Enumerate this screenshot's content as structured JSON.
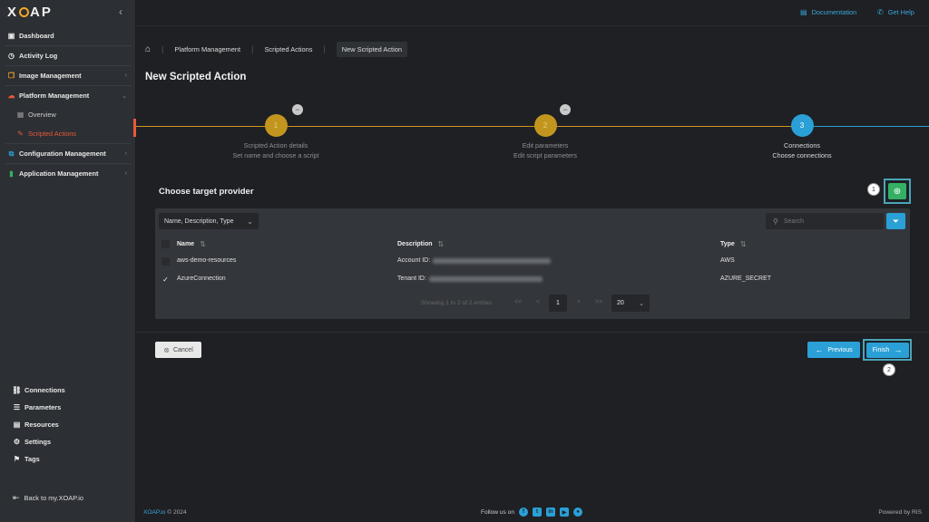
{
  "app": {
    "logo_prefix": "X",
    "logo_suffix": "AP"
  },
  "topbar": {
    "documentation": "Documentation",
    "help": "Get Help"
  },
  "sidebar": {
    "items": [
      {
        "label": "Dashboard"
      },
      {
        "label": "Activity Log"
      },
      {
        "label": "Image Management"
      },
      {
        "label": "Platform Management"
      },
      {
        "label": "Overview"
      },
      {
        "label": "Scripted Actions"
      },
      {
        "label": "Configuration Management"
      },
      {
        "label": "Application Management"
      }
    ],
    "bottom_items": [
      {
        "label": "Connections"
      },
      {
        "label": "Parameters"
      },
      {
        "label": "Resources"
      },
      {
        "label": "Settings"
      },
      {
        "label": "Tags"
      }
    ],
    "back_label": "Back to my.XOAP.io"
  },
  "breadcrumb": [
    "Platform Management",
    "Scripted Actions",
    "New Scripted Action"
  ],
  "page_title": "New Scripted Action",
  "stepper": [
    {
      "number": "1",
      "title": "Scripted Action details",
      "subtitle": "Set name and choose a script"
    },
    {
      "number": "2",
      "title": "Edit parameters",
      "subtitle": "Edit script parameters"
    },
    {
      "number": "3",
      "title": "Connections",
      "subtitle": "Choose connections"
    }
  ],
  "section_title": "Choose target provider",
  "filter": {
    "selected": "Name, Description, Type",
    "search_placeholder": "Search"
  },
  "table": {
    "headers": [
      "Name",
      "Description",
      "Type"
    ],
    "rows": [
      {
        "name": "aws-demo-resources",
        "description_label": "Account ID:",
        "type": "AWS",
        "checked": false
      },
      {
        "name": "AzureConnection",
        "description_label": "Tenant ID:",
        "type": "AZURE_SECRET",
        "checked": true
      }
    ]
  },
  "pagination": {
    "info": "Showing 1 to 2 of 2 entries",
    "first": "<<",
    "prev": "<",
    "current": "1",
    "next": ">",
    "last": ">>",
    "page_size": "20"
  },
  "callouts": {
    "add": "1",
    "finish": "2"
  },
  "actions": {
    "cancel": "Cancel",
    "previous": "Previous",
    "finish": "Finish"
  },
  "footer": {
    "brand": "XOAP.io",
    "copyright": "© 2024",
    "follow": "Follow us on",
    "powered": "Powered by RIS"
  },
  "colors": {
    "accent_blue": "#2aa0d6",
    "accent_orange": "#e8593a",
    "step_done": "#c2961e",
    "add_green": "#34b064"
  }
}
